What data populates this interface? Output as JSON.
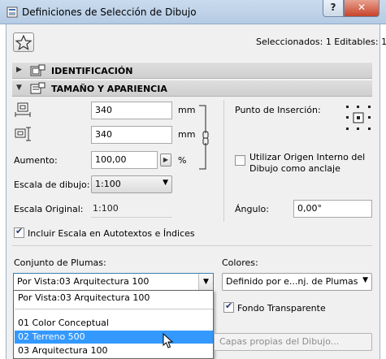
{
  "window": {
    "title": "Definiciones de Selección de Dibujo",
    "help_label": "?",
    "close_label": "✕"
  },
  "header": {
    "selected_info": "Seleccionados: 1 Editables: 1"
  },
  "sections": {
    "identificacion": "IDENTIFICACIÓN",
    "tamano": "TAMAÑO Y APARIENCIA"
  },
  "size": {
    "width_value": "340",
    "width_unit": "mm",
    "height_value": "340",
    "height_unit": "mm",
    "aumento_label": "Aumento:",
    "aumento_value": "100,00",
    "aumento_unit": "%",
    "escala_dibujo_label": "Escala de dibujo:",
    "escala_dibujo_value": "1:100",
    "escala_original_label": "Escala Original:",
    "escala_original_value": "1:100"
  },
  "right_panel": {
    "punto_insercion_label": "Punto de Inserción:",
    "origen_interno_label_line1": "Utilizar Origen Interno del",
    "origen_interno_label_line2": "Dibujo como anclaje",
    "origen_interno_checked": false,
    "angulo_label": "Ángulo:",
    "angulo_value": "0,00°"
  },
  "incluir_escala": {
    "label": "Incluir Escala en Autotextos e Índices",
    "checked": true
  },
  "plumas": {
    "label": "Conjunto de Plumas:",
    "selected_value": "Por Vista:03 Arquitectura 100",
    "options": [
      {
        "label": "Por Vista:03 Arquitectura 100",
        "highlighted": false
      },
      {
        "label": "01 Color Conceptual",
        "highlighted": false
      },
      {
        "label": "02 Terreno 500",
        "highlighted": true
      },
      {
        "label": "03 Arquitectura 100",
        "highlighted": false
      }
    ]
  },
  "colores": {
    "label": "Colores:",
    "value": "Definido por e...nj. de Plumas",
    "fondo_transparente_label": "Fondo Transparente",
    "fondo_transparente_checked": true,
    "capas_button_label": "Capas propias del Dibujo..."
  },
  "colors": {
    "selection": "#3399ff",
    "title_bar": "#c9dbee",
    "close_button": "#c7432a"
  }
}
